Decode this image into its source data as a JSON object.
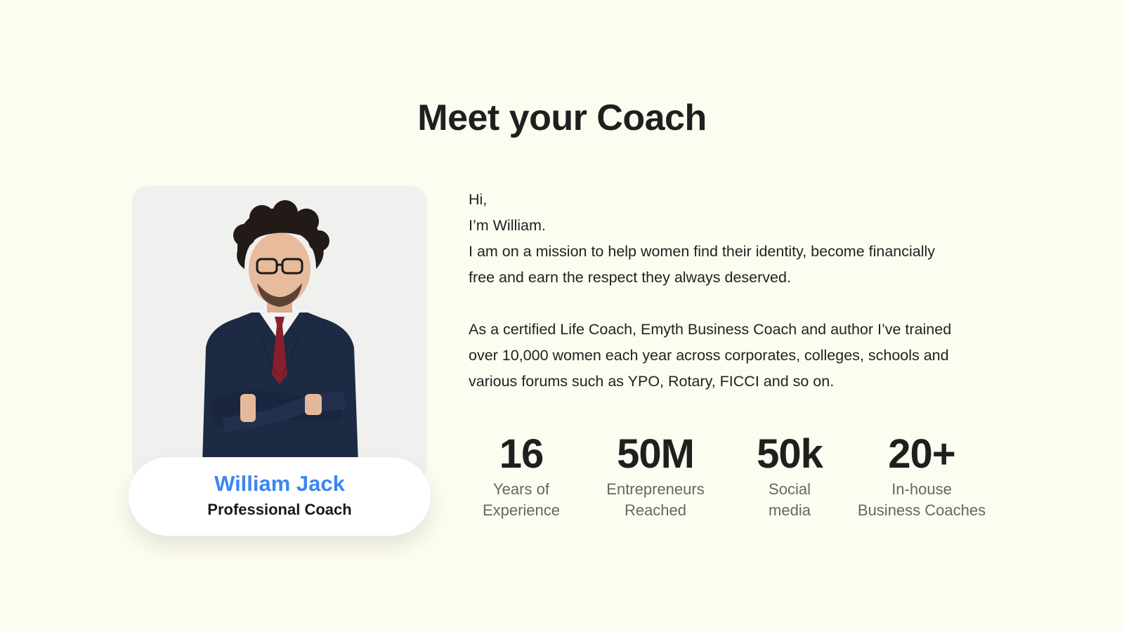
{
  "section": {
    "title": "Meet your Coach"
  },
  "coach": {
    "name": "William Jack",
    "role": "Professional Coach"
  },
  "bio": {
    "greeting": "Hi,",
    "intro": "I’m William.",
    "mission_line1": "I am on a mission to help women find their identity, become financially",
    "mission_line2": "free and earn the respect they always deserved.",
    "cred_line1": "As a certified Life Coach, Emyth Business Coach and author I’ve trained",
    "cred_line2": "over 10,000 women each year across corporates, colleges, schools and",
    "cred_line3": "various forums such as YPO, Rotary, FICCI and so on."
  },
  "stats": [
    {
      "value": "16",
      "label_line1": "Years of",
      "label_line2": "Experience"
    },
    {
      "value": "50M",
      "label_line1": "Entrepreneurs",
      "label_line2": "Reached"
    },
    {
      "value": "50k",
      "label_line1": "Social",
      "label_line2": "media"
    },
    {
      "value": "20+",
      "label_line1": "In-house",
      "label_line2": "Business Coaches"
    }
  ],
  "colors": {
    "background": "#fdfcf0",
    "accent": "#3b86f1",
    "card": "#f0f1ef"
  }
}
